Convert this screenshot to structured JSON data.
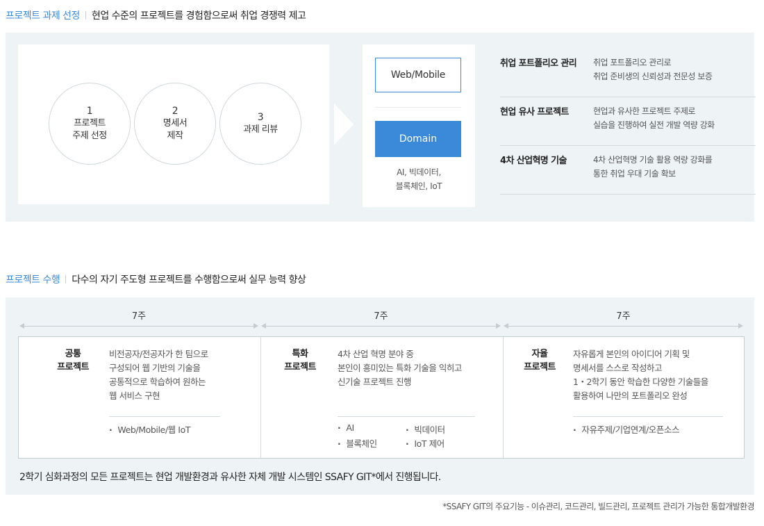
{
  "section1": {
    "title_accent": "프로젝트 과제 선정",
    "title_rest": "현업 수준의 프로젝트를 경험함으로써 취업 경쟁력 제고",
    "steps": [
      {
        "num": "1",
        "line1": "프로젝트",
        "line2": "주제 선정"
      },
      {
        "num": "2",
        "line1": "명세서",
        "line2": "제작"
      },
      {
        "num": "3",
        "line1": "과제 리뷰",
        "line2": ""
      }
    ],
    "web_label": "Web/Mobile",
    "domain_label": "Domain",
    "domain_sub1": "AI, 빅데이터,",
    "domain_sub2": "블록체인, IoT",
    "features": [
      {
        "title": "취업 포트폴리오 관리",
        "line1": "취업 포트폴리오 관리로",
        "line2": "취업 준비생의 신뢰성과 전문성 보증"
      },
      {
        "title": "현업 유사 프로젝트",
        "line1": "현업과 유사한 프로젝트 주제로",
        "line2": "실습을 진행하여 실전 개발 역량 강화"
      },
      {
        "title": "4차 산업혁명 기술",
        "line1": "4차 산업혁명 기술 활용 역량 강화를",
        "line2": "통한 취업 우대 기술 확보"
      }
    ]
  },
  "section2": {
    "title_accent": "프로젝트 수행",
    "title_rest": "다수의 자기 주도형 프로젝트를 수행함으로써 실무 능력 향상",
    "weeks": [
      "7주",
      "7주",
      "7주"
    ],
    "projects": [
      {
        "title1": "공통",
        "title2": "프로젝트",
        "desc": [
          "비전공자/전공자가 한 팀으로",
          "구성되어 웹 기반의 기술을",
          "공통적으로 학습하여 원하는",
          "웹 서비스 구현"
        ],
        "bullets": [
          "Web/Mobile/웹 IoT"
        ]
      },
      {
        "title1": "특화",
        "title2": "프로젝트",
        "desc": [
          "4차 산업 혁명 분야 중",
          "본인이 흥미있는 특화 기술을 익히고",
          "신기술 프로젝트 진행"
        ],
        "bullets": [
          "AI",
          "빅데이터",
          "블록체인",
          "IoT 제어"
        ]
      },
      {
        "title1": "자율",
        "title2": "프로젝트",
        "desc": [
          "자유롭게 본인의 아이디어 기획 및",
          "명세서를 스스로 작성하고",
          "1・2학기 동안 학습한 다양한 기술들을",
          "활용하여 나만의 포트폴리오 완성"
        ],
        "bullets": [
          "자유주제/기업연계/오픈소스"
        ]
      }
    ],
    "note": "2학기 심화과정의 모든 프로젝트는 현업 개발환경과 유사한 자체 개발 시스템인 SSAFY GIT*에서 진행됩니다."
  },
  "footnote": "*SSAFY GIT의 주요기능 - 이슈관리, 코드관리, 빌드관리, 프로젝트 관리가 가능한 통합개발환경",
  "colors": {
    "accent": "#3b8ad9",
    "panel": "#eef3f6"
  }
}
